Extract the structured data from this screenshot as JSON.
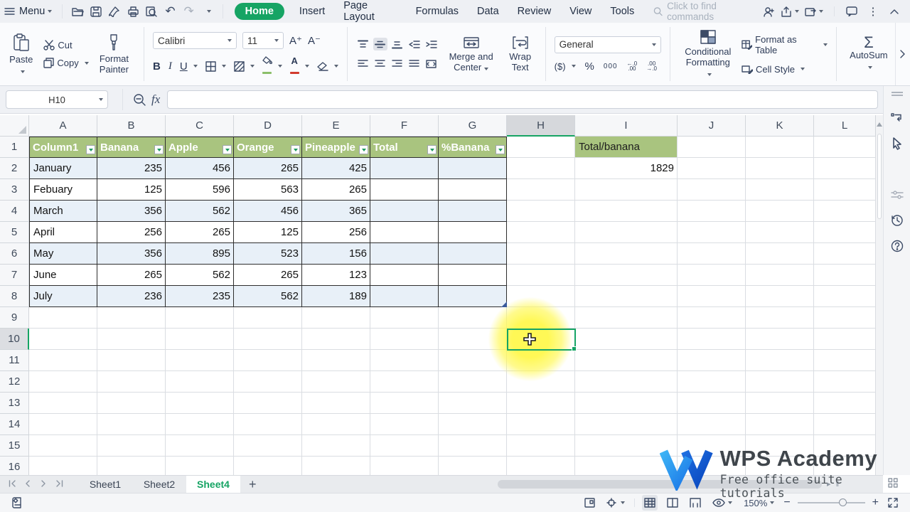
{
  "menubar": {
    "menu_label": "Menu",
    "tabs": [
      "Home",
      "Insert",
      "Page Layout",
      "Formulas",
      "Data",
      "Review",
      "View",
      "Tools"
    ],
    "active_tab": "Home",
    "search_placeholder": "Click to find commands",
    "quick_icons": [
      "open-icon",
      "save-icon",
      "pin-icon",
      "print-icon",
      "preview-icon",
      "undo-icon",
      "redo-icon",
      "more-commands-chevron"
    ],
    "right_icons": [
      "invite-user-icon",
      "share-icon",
      "open-in-window-icon",
      "comment-icon",
      "more-options-icon",
      "collapse-ribbon-icon"
    ]
  },
  "ribbon": {
    "paste": "Paste",
    "cut": "Cut",
    "copy": "Copy",
    "format_painter": "Format Painter",
    "font_name": "Calibri",
    "font_size": "11",
    "merge_center": "Merge and Center",
    "wrap_text": "Wrap Text",
    "number_format": "General",
    "conditional_formatting_1": "Conditional",
    "conditional_formatting_2": "Formatting",
    "format_as_table": "Format as Table",
    "cell_style": "Cell Style",
    "autosum": "AutoSum"
  },
  "formula_bar": {
    "name_box": "H10",
    "fx_label": "fx",
    "formula_value": ""
  },
  "spreadsheet": {
    "column_headers": [
      "A",
      "B",
      "C",
      "D",
      "E",
      "F",
      "G",
      "H",
      "I",
      "J",
      "K",
      "L"
    ],
    "selected_column": "H",
    "selected_row": 10,
    "selected_cell": "H10",
    "visible_rows": 16,
    "table": {
      "headers": [
        "Column1",
        "Banana",
        "Apple",
        "Orange",
        "Pineapple",
        "Total",
        "%Banana"
      ],
      "rows": [
        [
          "January",
          "235",
          "456",
          "265",
          "425",
          "",
          ""
        ],
        [
          "Febuary",
          "125",
          "596",
          "563",
          "265",
          "",
          ""
        ],
        [
          "March",
          "356",
          "562",
          "456",
          "365",
          "",
          ""
        ],
        [
          "April",
          "256",
          "265",
          "125",
          "256",
          "",
          ""
        ],
        [
          "May",
          "356",
          "895",
          "523",
          "156",
          "",
          ""
        ],
        [
          "June",
          "265",
          "562",
          "265",
          "123",
          "",
          ""
        ],
        [
          "July",
          "236",
          "235",
          "562",
          "189",
          "",
          ""
        ]
      ]
    },
    "side_cells": {
      "i1_label": "Total/banana",
      "i2_value": "1829"
    }
  },
  "sheet_bar": {
    "sheets": [
      "Sheet1",
      "Sheet2",
      "Sheet4"
    ],
    "active_sheet": "Sheet4",
    "add_label": "+",
    "nav_icons": [
      "first-sheet-icon",
      "prev-sheet-icon",
      "next-sheet-icon",
      "last-sheet-icon"
    ]
  },
  "status_bar": {
    "zoom_level": "150%",
    "view_icons": [
      "reading-mode-icon",
      "locate-center-icon",
      "normal-view-icon",
      "page-layout-view-icon",
      "page-break-view-icon",
      "eye-protection-icon",
      "fit-screen-icon"
    ]
  },
  "watermark": {
    "title": "WPS Academy",
    "subtitle": "Free office suite tutorials"
  },
  "glyphs": {
    "autosum_sigma": "Σ",
    "bold": "B",
    "italic": "I",
    "underline": "U",
    "font_bigger": "A⁺",
    "font_smaller": "A⁻",
    "dollar": "$",
    "percent": "%",
    "thousands": "000",
    "font_color_a": "A",
    "undo": "↶",
    "redo": "↷",
    "dots": "⋮",
    "hmarks": "▸ ‖"
  },
  "colors": {
    "accent_green": "#16a464",
    "table_header_green": "#a9c47f",
    "band_blue": "#e8f0f8",
    "selection_green": "#14a05c",
    "highlight_yellow": "#fff850"
  }
}
